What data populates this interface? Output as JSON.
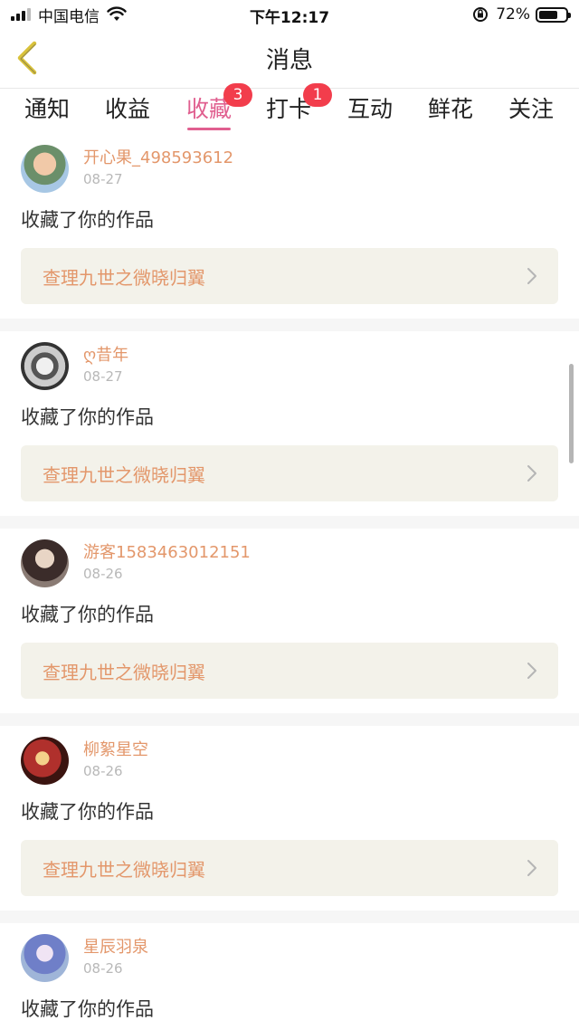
{
  "status_bar": {
    "carrier": "中国电信",
    "time": "下午12:17",
    "battery": "72%",
    "battery_level": 0.72
  },
  "nav": {
    "title": "消息",
    "back_icon": "chevron-left-icon"
  },
  "tabs": [
    {
      "label": "通知",
      "active": false,
      "badge": ""
    },
    {
      "label": "收益",
      "active": false,
      "badge": ""
    },
    {
      "label": "收藏",
      "active": true,
      "badge": "3"
    },
    {
      "label": "打卡",
      "active": false,
      "badge": "1"
    },
    {
      "label": "互动",
      "active": false,
      "badge": ""
    },
    {
      "label": "鲜花",
      "active": false,
      "badge": ""
    },
    {
      "label": "关注",
      "active": false,
      "badge": ""
    }
  ],
  "messages": [
    {
      "user": "开心果_498593612",
      "date": "08-27",
      "action": "收藏了你的作品",
      "work": "查理九世之微晓归翼"
    },
    {
      "user": "ღ昔年",
      "date": "08-27",
      "action": "收藏了你的作品",
      "work": "查理九世之微晓归翼"
    },
    {
      "user": "游客1583463012151",
      "date": "08-26",
      "action": "收藏了你的作品",
      "work": "查理九世之微晓归翼"
    },
    {
      "user": "柳絮星空",
      "date": "08-26",
      "action": "收藏了你的作品",
      "work": "查理九世之微晓归翼"
    },
    {
      "user": "星辰羽泉",
      "date": "08-26",
      "action": "收藏了你的作品",
      "work": ""
    }
  ],
  "colors": {
    "accent": "#e05f8f",
    "username": "#e3976b",
    "badge": "#f23d4c",
    "card_bg": "#f3f2ea"
  }
}
